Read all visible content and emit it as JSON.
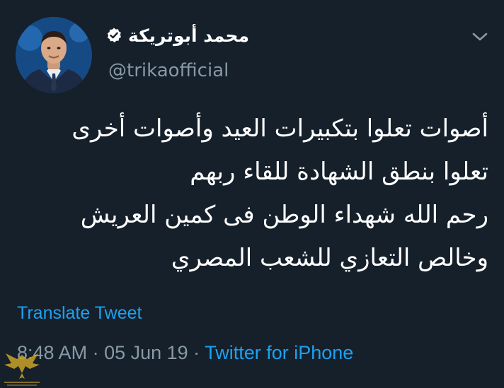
{
  "user": {
    "display_name": "محمد أبوتريكة",
    "handle": "@trikaofficial",
    "verified": true
  },
  "icons": {
    "avatar": "profile-photo",
    "verified": "verified-badge-icon",
    "menu": "chevron-down-icon",
    "watermark": "golden-eagle-logo"
  },
  "tweet": {
    "lines": [
      "أصوات تعلوا بتكبيرات العيد وأصوات أخرى",
      "تعلوا بنطق الشهادة للقاء ربهم",
      "رحم الله شهداء الوطن فى كمين العريش",
      "وخالص التعازي للشعب المصري"
    ]
  },
  "translate_label": "Translate Tweet",
  "meta": {
    "time": "8:48 AM",
    "separator": " · ",
    "date": "05 Jun 19",
    "source": "Twitter for iPhone"
  },
  "colors": {
    "background": "#15202b",
    "link": "#1da1f2",
    "secondary_text": "#8899a6",
    "primary_text": "#ffffff"
  }
}
